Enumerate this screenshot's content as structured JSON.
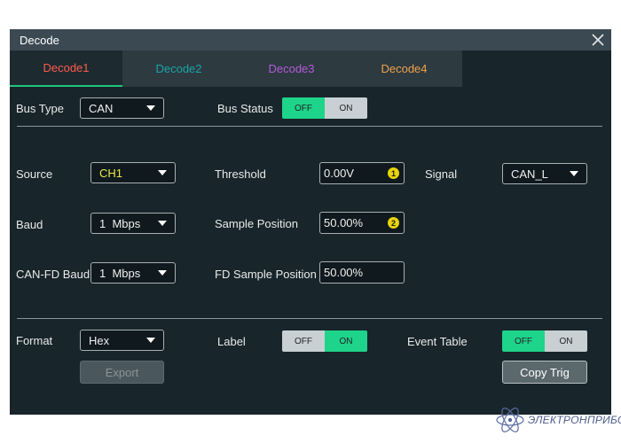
{
  "window": {
    "title": "Decode"
  },
  "tabs": [
    {
      "label": "Decode1",
      "color": "#ff5a4e",
      "active": true
    },
    {
      "label": "Decode2",
      "color": "#1aa5a8",
      "active": false
    },
    {
      "label": "Decode3",
      "color": "#b45bdc",
      "active": false
    },
    {
      "label": "Decode4",
      "color": "#f0a24a",
      "active": false
    }
  ],
  "bus_type": {
    "label": "Bus Type",
    "value": "CAN"
  },
  "bus_status": {
    "label": "Bus Status",
    "off": "OFF",
    "on": "ON",
    "state": "OFF"
  },
  "source": {
    "label": "Source",
    "value": "CH1",
    "value_color": "#ece84a"
  },
  "threshold": {
    "label": "Threshold",
    "value": "0.00V",
    "badge": "1"
  },
  "signal": {
    "label": "Signal",
    "value": "CAN_L"
  },
  "baud": {
    "label": "Baud",
    "value": "1  Mbps"
  },
  "sample_position": {
    "label": "Sample Position",
    "value": "50.00%",
    "badge": "2"
  },
  "canfd_baud": {
    "label": "CAN-FD Baud",
    "value": "1  Mbps"
  },
  "fd_sample_position": {
    "label": "FD Sample Position",
    "value": "50.00%"
  },
  "format": {
    "label": "Format",
    "value": "Hex"
  },
  "label_toggle": {
    "label": "Label",
    "off": "OFF",
    "on": "ON",
    "state": "ON"
  },
  "event_table": {
    "label": "Event Table",
    "off": "OFF",
    "on": "ON",
    "state": "OFF"
  },
  "buttons": {
    "export": "Export",
    "copy_trig": "Copy Trig"
  },
  "brand": {
    "name": "ЭЛЕКТРОНПРИБОР"
  },
  "colors": {
    "accent_on": "#1ed48a",
    "panel": "#18252a",
    "titlebar": "#3b4a52"
  }
}
